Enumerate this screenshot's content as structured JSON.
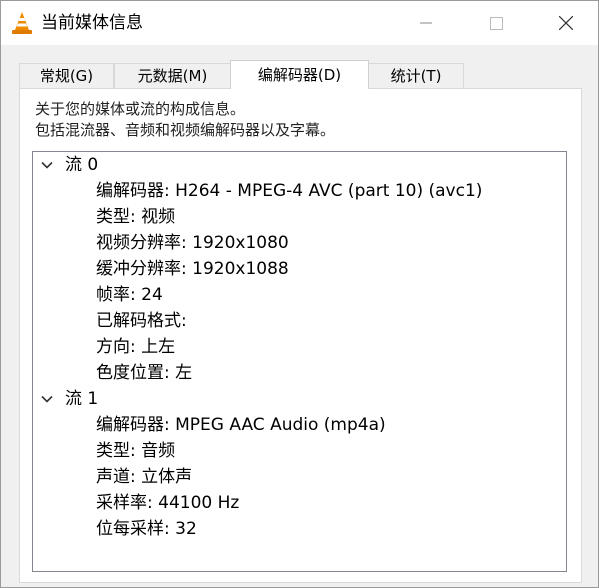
{
  "window": {
    "title": "当前媒体信息"
  },
  "tabs": [
    {
      "label": "常规(G)"
    },
    {
      "label": "元数据(M)"
    },
    {
      "label": "编解码器(D)",
      "active": true
    },
    {
      "label": "统计(T)"
    }
  ],
  "description": {
    "line1": "关于您的媒体或流的构成信息。",
    "line2": "包括混流器、音频和视频编解码器以及字幕。"
  },
  "streams": [
    {
      "label": "流 0",
      "expanded": true,
      "properties": [
        "编解码器: H264 - MPEG-4 AVC (part 10) (avc1)",
        "类型: 视频",
        "视频分辨率: 1920x1080",
        "缓冲分辨率: 1920x1088",
        "帧率: 24",
        "已解码格式:",
        "方向: 上左",
        "色度位置: 左"
      ]
    },
    {
      "label": "流 1",
      "expanded": true,
      "properties": [
        "编解码器: MPEG AAC Audio (mp4a)",
        "类型: 音频",
        "声道: 立体声",
        "采样率: 44100 Hz",
        "位每采样: 32"
      ]
    }
  ],
  "icons": {
    "app": "vlc-cone-icon",
    "minimize": "minimize-icon",
    "maximize": "maximize-icon",
    "close": "close-icon",
    "expand": "chevron-down-icon"
  },
  "colors": {
    "vlc_orange": "#f08a00",
    "tree_border": "#828790"
  }
}
